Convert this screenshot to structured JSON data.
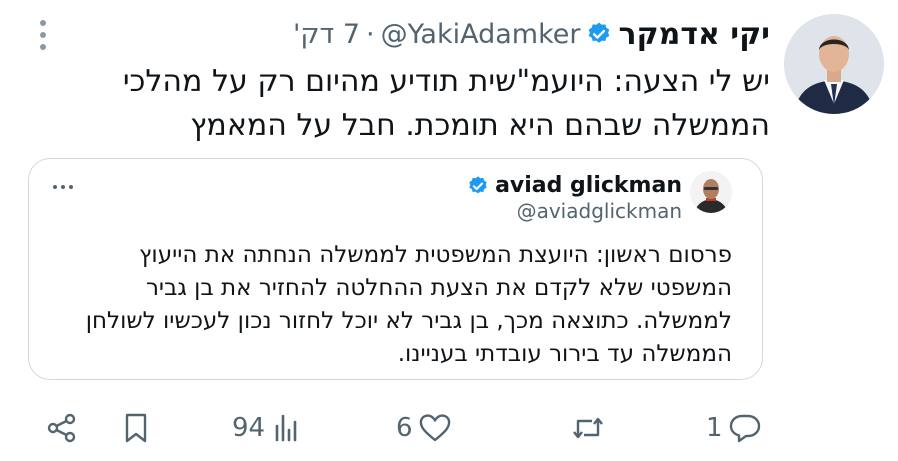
{
  "author": {
    "display_name": "יקי אדמקר",
    "handle": "@YakiAdamker",
    "separator": "·",
    "time": "7 דק'"
  },
  "tweet": {
    "text": "יש לי הצעה: היועמ\"שית תודיע מהיום רק על מהלכי הממשלה שבהם היא תומכת. חבל על המאמץ"
  },
  "quote": {
    "display_name": "aviad glickman",
    "handle": "@aviadglickman",
    "text": "פרסום ראשון: היועצת המשפטית לממשלה הנחתה את הייעוץ המשפטי שלא לקדם את הצעת ההחלטה להחזיר את בן גביר לממשלה. כתוצאה מכך, בן גביר לא יוכל לחזור נכון לעכשיו לשולחן הממשלה עד בירור עובדתי בעניינו."
  },
  "actions": {
    "replies": "1",
    "retweets": "",
    "likes": "6",
    "views": "94"
  },
  "colors": {
    "verified": "#1d9bf0",
    "secondary_text": "#536471",
    "border": "#cfd9de"
  },
  "icons": {
    "more": "more-vertical-icon",
    "verified": "verified-badge-icon",
    "reply": "reply-icon",
    "retweet": "retweet-icon",
    "like": "heart-icon",
    "views": "views-icon",
    "bookmark": "bookmark-icon",
    "share": "share-icon"
  }
}
